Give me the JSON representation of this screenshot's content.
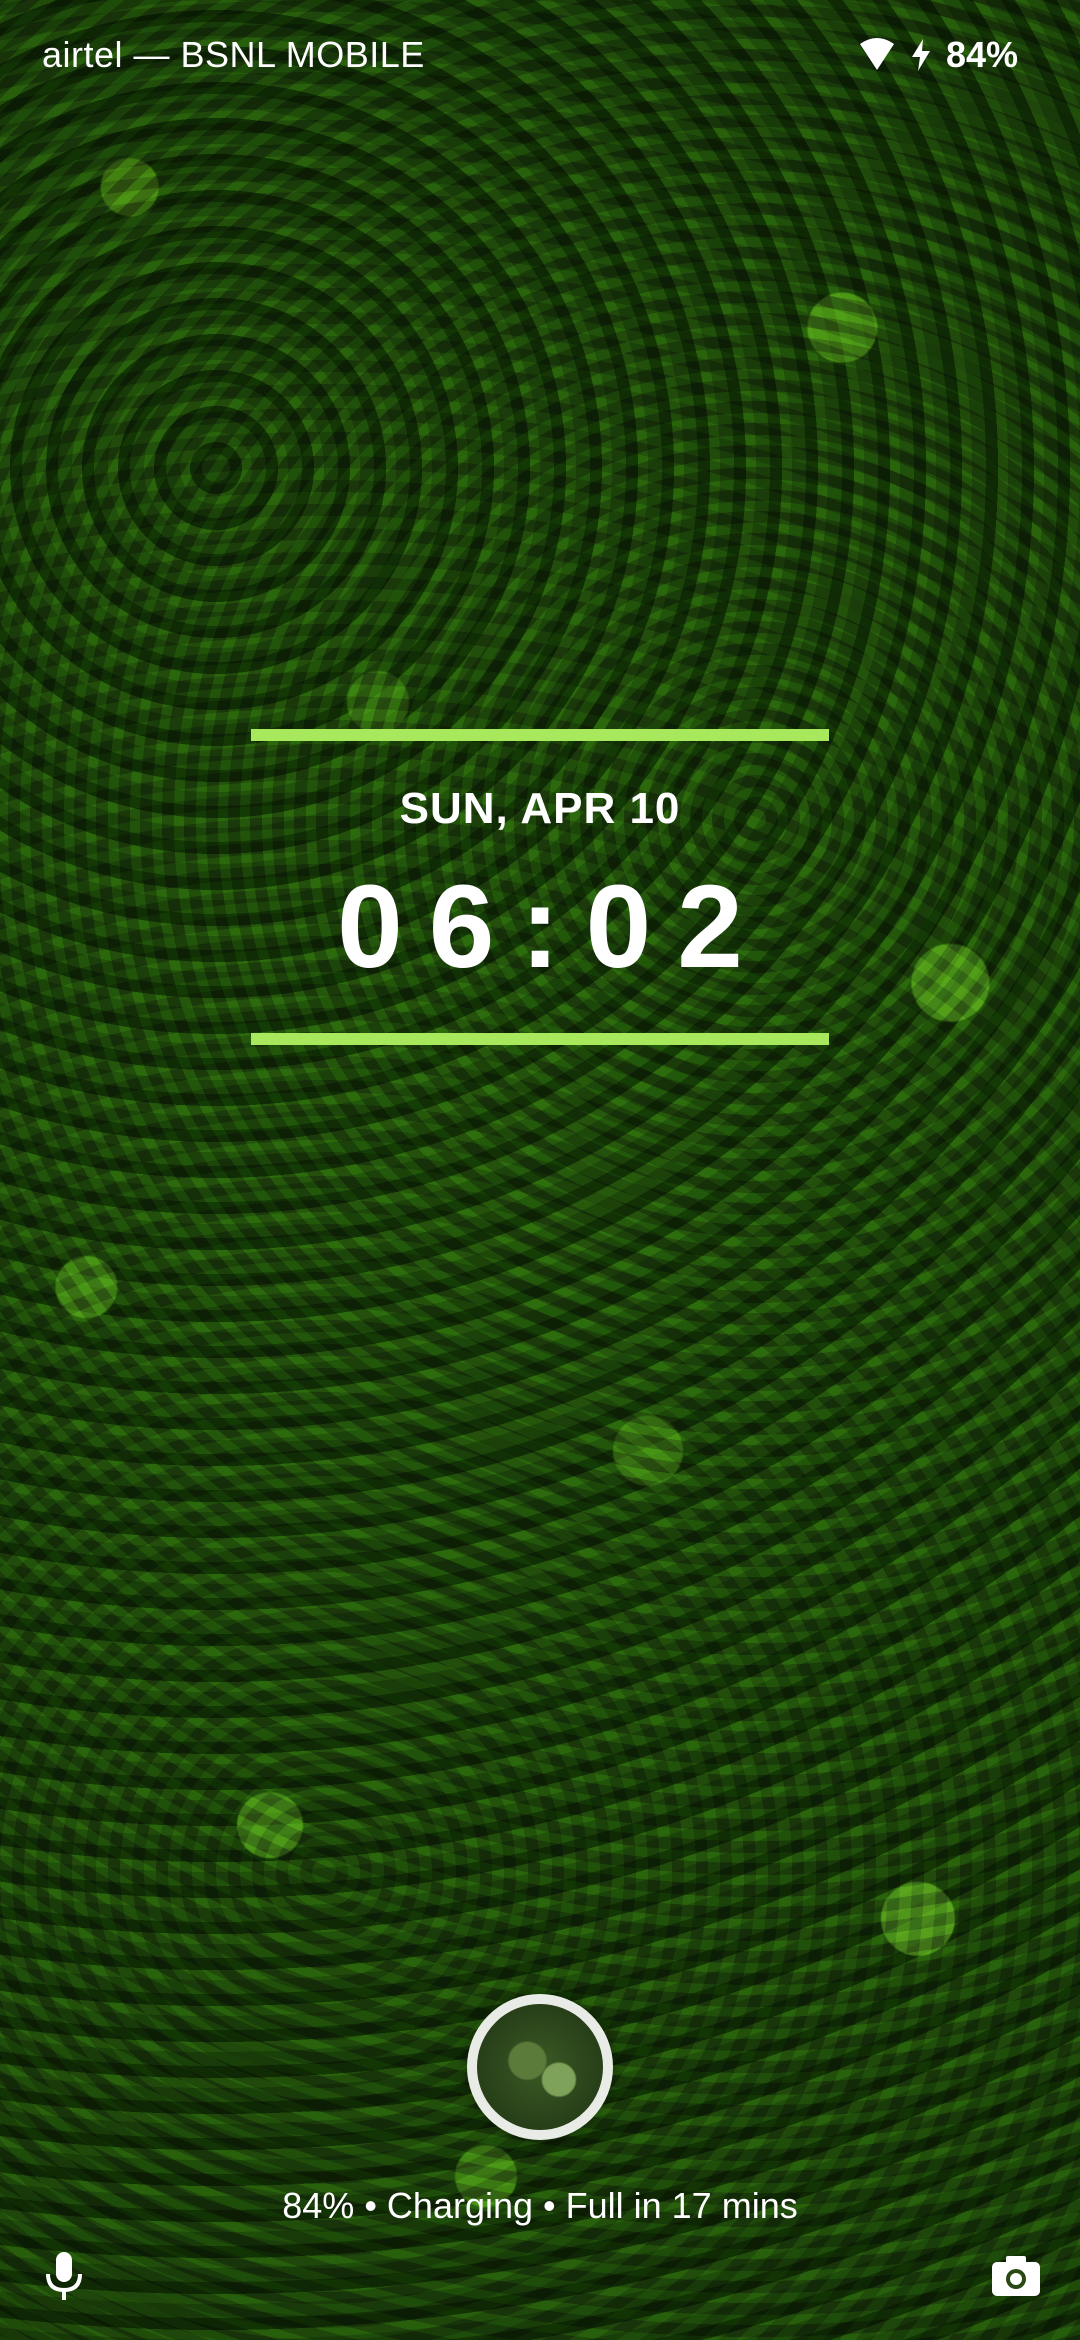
{
  "status_bar": {
    "carrier": "airtel — BSNL MOBILE",
    "battery_percent": "84%",
    "icons": [
      "wifi-icon",
      "charging-bolt-icon"
    ]
  },
  "clock": {
    "date": "SUN, APR 10",
    "time": "06:02",
    "accent_color": "#a8e85c"
  },
  "lockscreen": {
    "charging_status": "84% • Charging • Full in 17 mins",
    "left_shortcut": "mic-icon",
    "right_shortcut": "camera-icon"
  }
}
